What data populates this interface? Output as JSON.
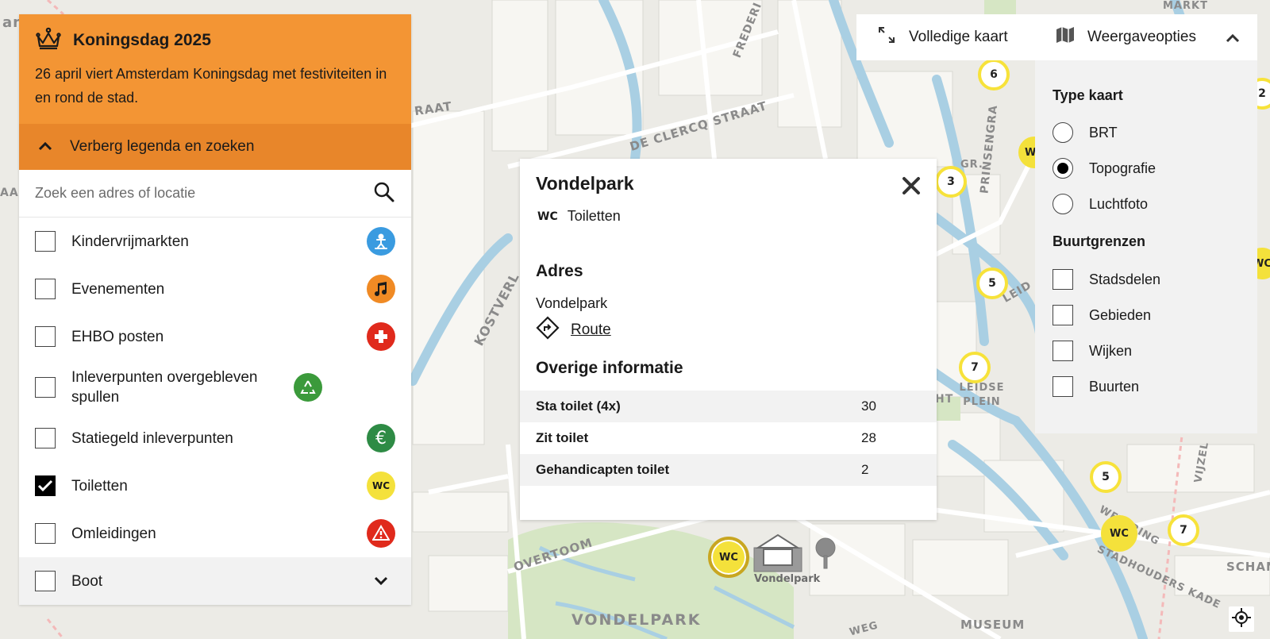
{
  "banner": {
    "title": "Koningsdag 2025",
    "text": "26 april viert Amsterdam Koningsdag met festiviteiten in en rond de stad.",
    "toggle_label": "Verberg legenda en zoeken",
    "color": "#f39534"
  },
  "search": {
    "placeholder": "Zoek een adres of locatie",
    "value": ""
  },
  "legend": {
    "items": [
      {
        "label": "Kindervrijmarkten",
        "checked": false,
        "icon": "child-icon",
        "color": "#3a9be0"
      },
      {
        "label": "Evenementen",
        "checked": false,
        "icon": "music-icon",
        "color": "#f08a24"
      },
      {
        "label": "EHBO posten",
        "checked": false,
        "icon": "first-aid-icon",
        "color": "#e02a1c"
      },
      {
        "label": "Inleverpunten overgebleven spullen",
        "checked": false,
        "icon": "recycle-icon",
        "color": "#3b9a3b"
      },
      {
        "label": "Statiegeld inleverpunten",
        "checked": false,
        "icon": "euro-icon",
        "color": "#2e8b45"
      },
      {
        "label": "Toiletten",
        "checked": true,
        "icon": "wc-icon",
        "icon_text": "WC",
        "color": "#f4e13b"
      },
      {
        "label": "Omleidingen",
        "checked": false,
        "icon": "warning-icon",
        "color": "#e02a1c"
      },
      {
        "label": "Boot",
        "checked": false,
        "icon": "chevron-down-icon"
      }
    ]
  },
  "popup": {
    "title": "Vondelpark",
    "type_icon": "WC",
    "type_label": "Toiletten",
    "address_heading": "Adres",
    "address": "Vondelpark",
    "route_label": "Route",
    "info_heading": "Overige informatie",
    "info_rows": [
      {
        "key": "Sta toilet (4x)",
        "value": "30"
      },
      {
        "key": "Zit toilet",
        "value": "28"
      },
      {
        "key": "Gehandicapten toilet",
        "value": "2"
      }
    ]
  },
  "controls": {
    "fullmap_label": "Volledige kaart",
    "options_label": "Weergaveopties"
  },
  "options": {
    "map_type_heading": "Type kaart",
    "map_types": [
      {
        "label": "BRT",
        "selected": false
      },
      {
        "label": "Topografie",
        "selected": true
      },
      {
        "label": "Luchtfoto",
        "selected": false
      }
    ],
    "borders_heading": "Buurtgrenzen",
    "borders": [
      {
        "label": "Stadsdelen",
        "checked": false
      },
      {
        "label": "Gebieden",
        "checked": false
      },
      {
        "label": "Wijken",
        "checked": false
      },
      {
        "label": "Buurten",
        "checked": false
      }
    ]
  },
  "map": {
    "street_labels": [
      "RAAT",
      "DE CLERCQ STRAAT",
      "FREDERI",
      "KOSTVERL",
      "PRINSENGRA",
      "LEIDSE PLEIN",
      "LEID",
      "OVERTOOM",
      "VONDELPARK",
      "MUSEUM",
      "STADHOUDERS KADE",
      "WETERING",
      "SCHANS",
      "VIJZEL",
      "MARKT",
      "GR.",
      "HT",
      "WEG",
      "Vondelpark",
      "AA",
      "an"
    ],
    "clusters": [
      "6",
      "3",
      "5",
      "7",
      "5",
      "7",
      "2"
    ],
    "wc_label": "WC"
  }
}
